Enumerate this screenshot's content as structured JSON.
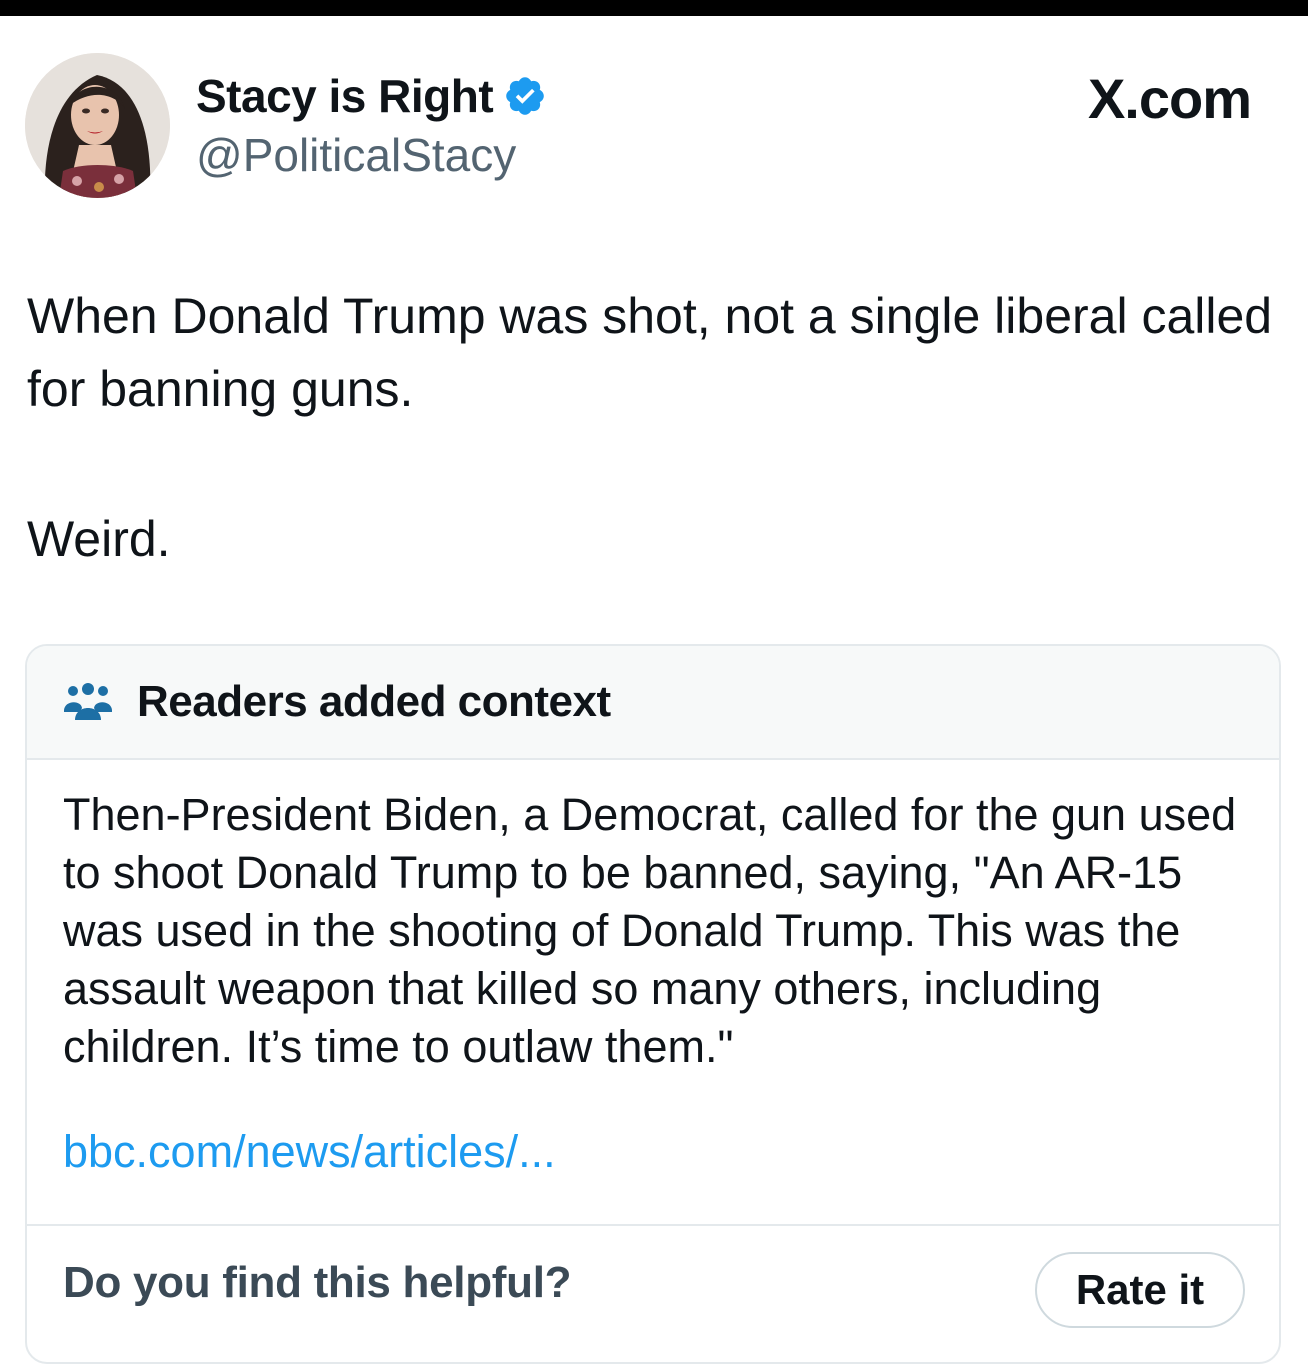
{
  "tweet": {
    "display_name": "Stacy is Right",
    "handle": "@PoliticalStacy",
    "site": "X.com",
    "text_line_1": "When Donald Trump was shot, not a single liberal called for banning guns.",
    "text_line_2": "Weird."
  },
  "community_note": {
    "title": "Readers added context",
    "body": "Then-President Biden, a Democrat, called for the gun used to shoot Donald Trump to be banned, saying, \"An AR-15 was used in the shooting of Donald Trump. This was the assault weapon that killed so many others, including children. It’s time to outlaw them.\"",
    "link": "bbc.com/news/articles/...",
    "helpful_question": "Do you find this helpful?",
    "rate_button": "Rate it"
  },
  "colors": {
    "verified": "#1d9bf0",
    "link": "#1d9bf0",
    "note_header_bg": "#f7f9f9",
    "border": "#e4e9ec"
  },
  "icons": {
    "verified": "verified-badge-icon",
    "readers": "people-icon"
  }
}
